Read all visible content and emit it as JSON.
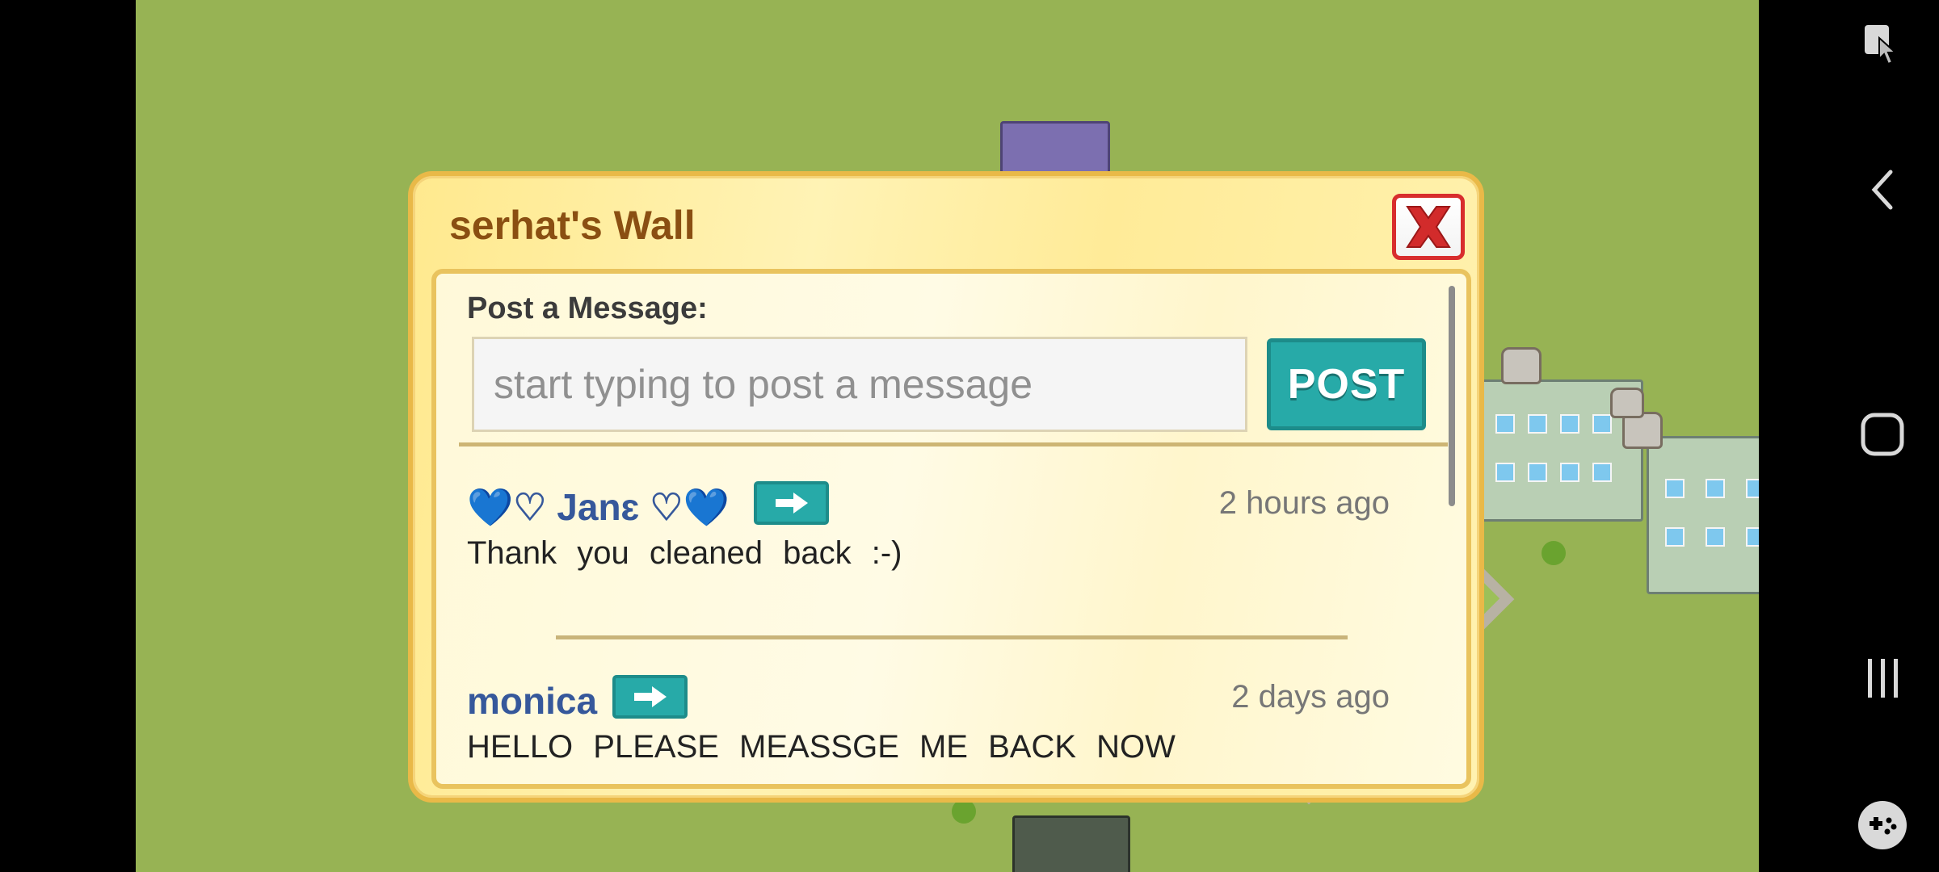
{
  "dialog": {
    "title": "serhat's Wall",
    "post_label": "Post a Message:",
    "input_placeholder": "start typing to post a message",
    "post_button": "POST"
  },
  "posts": [
    {
      "author": "💙♡ Janɛ ♡💙",
      "time": "2 hours ago",
      "message": "Thank you cleaned back :-)"
    },
    {
      "author": "monica",
      "time": "2 days ago",
      "message": "HELLO PLEASE MEASSGE ME BACK NOW"
    }
  ],
  "icons": {
    "close": "close-x-icon",
    "arrow": "arrow-right-icon",
    "nav": [
      "screen-touch-icon",
      "back-icon",
      "home-icon",
      "recents-icon",
      "game-controller-icon"
    ]
  },
  "colors": {
    "game_background": "#97b354",
    "dialog_border": "#e9b948",
    "title": "#8a4f12",
    "post_button": "#27aaa8",
    "author": "#36589b",
    "close_border": "#d82d2d"
  }
}
